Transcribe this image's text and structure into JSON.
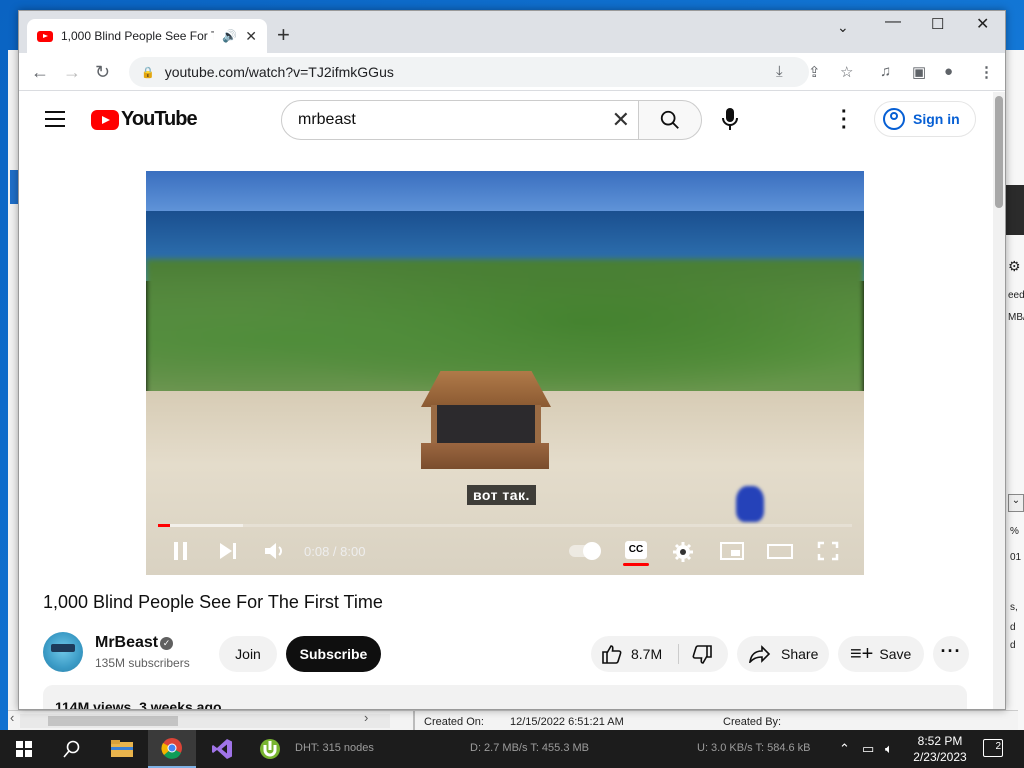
{
  "browser": {
    "tab_title": "1,000 Blind People See For T",
    "new_tab": "+",
    "url": "youtube.com/watch?v=TJ2ifmkGGus"
  },
  "youtube": {
    "logo_text": "YouTube",
    "search_value": "mrbeast",
    "sign_in": "Sign in",
    "player": {
      "subtitle": "вот так.",
      "time": "0:08 / 8:00",
      "progress_fraction": 0.017
    },
    "video": {
      "title": "1,000 Blind People See For The First Time",
      "channel_name": "MrBeast",
      "subscribers": "135M subscribers",
      "join": "Join",
      "subscribe": "Subscribe",
      "likes": "8.7M",
      "share": "Share",
      "save": "Save",
      "views": "114M views",
      "age": "3 weeks ago"
    }
  },
  "background_window": {
    "created_on_label": "Created On:",
    "created_on_value": "12/15/2022 6:51:21 AM",
    "created_by_label": "Created By:",
    "right_texts": [
      "eed",
      "MB/",
      "%",
      "01",
      "s,",
      "d",
      "d"
    ]
  },
  "taskbar": {
    "dht": "DHT: 315 nodes",
    "down": "D: 2.7 MB/s T: 455.3 MB",
    "up": "U: 3.0 KB/s T: 584.6 kB",
    "time": "8:52 PM",
    "date": "2/23/2023",
    "notifications": "2"
  },
  "colors": {
    "youtube_red": "#ff0000",
    "link_blue": "#065fd4",
    "taskbar": "#1c1c1c"
  }
}
